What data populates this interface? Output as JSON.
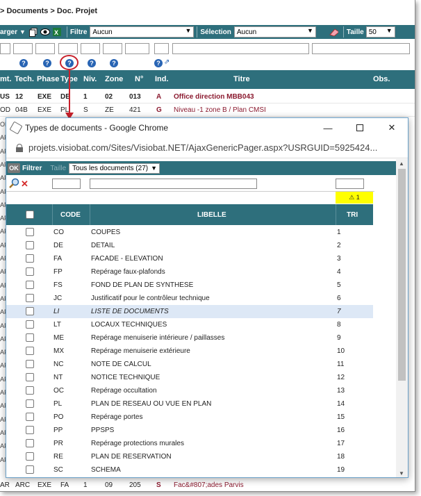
{
  "breadcrumb": "> Documents > Doc. Projet",
  "toolbar": {
    "charger_label": "arger",
    "filtre_label": "Filtre",
    "filtre_value": "Aucun",
    "selection_label": "Sélection",
    "selection_value": "Aucun",
    "taille_label": "Taille",
    "taille_value": "50"
  },
  "bg_table": {
    "headers": [
      "mt.",
      "Tech.",
      "Phase",
      "Type",
      "Niv.",
      "Zone",
      "N°",
      "Ind.",
      "Titre",
      "Obs."
    ],
    "rows": [
      {
        "mt": "US",
        "tech": "12",
        "phase": "EXE",
        "type": "DE",
        "niv": "1",
        "zone": "02",
        "num": "013",
        "ind": "A",
        "titre": "Office direction MBB043"
      },
      {
        "mt": "OD",
        "tech": "04B",
        "phase": "EXE",
        "type": "PL",
        "niv": "S",
        "zone": "ZE",
        "num": "421",
        "ind": "G",
        "titre": "Niveau -1 zone B / Plan CMSI"
      }
    ],
    "left_stub": [
      "OD",
      "AF",
      "AF",
      "AF",
      "AF",
      "AF",
      "AF",
      "AF",
      "AF",
      "AF",
      "AF",
      "AF",
      "AF",
      "AF",
      "AF",
      "AF",
      "AF",
      "AF",
      "AF",
      "AF",
      "AF",
      "AF",
      "AF",
      "AF",
      "AF",
      "AF"
    ],
    "bottom_row": {
      "mt": "AR",
      "tech": "ARC",
      "phase": "EXE",
      "type": "FA",
      "niv": "1",
      "zone": "09",
      "num": "205",
      "ind": "S",
      "titre": "Fac&#807;ades Parvis"
    }
  },
  "popup": {
    "window_title": "Types de documents - Google Chrome",
    "url": "projets.visiobat.com/Sites/Visiobat.NET/AjaxGenericPager.aspx?USRGUID=5925424...",
    "ok_label": "OK",
    "filtrer_label": "Filtrer",
    "taille_label": "Taille",
    "taille_value": "Tous les documents (27)",
    "sort_badge": "1",
    "columns": {
      "code": "CODE",
      "libelle": "LIBELLE",
      "tri": "TRI"
    },
    "rows": [
      {
        "code": "CO",
        "libelle": "COUPES",
        "tri": "1"
      },
      {
        "code": "DE",
        "libelle": "DETAIL",
        "tri": "2"
      },
      {
        "code": "FA",
        "libelle": "FACADE - ELEVATION",
        "tri": "3"
      },
      {
        "code": "FP",
        "libelle": "Repérage faux-plafonds",
        "tri": "4"
      },
      {
        "code": "FS",
        "libelle": "FOND DE PLAN DE SYNTHESE",
        "tri": "5"
      },
      {
        "code": "JC",
        "libelle": "Justificatif pour le contrôleur technique",
        "tri": "6"
      },
      {
        "code": "LI",
        "libelle": "LISTE DE DOCUMENTS",
        "tri": "7"
      },
      {
        "code": "LT",
        "libelle": "LOCAUX TECHNIQUES",
        "tri": "8"
      },
      {
        "code": "ME",
        "libelle": "Repérage menuiserie intérieure / paillasses",
        "tri": "9"
      },
      {
        "code": "MX",
        "libelle": "Repérage menuiserie extérieure",
        "tri": "10"
      },
      {
        "code": "NC",
        "libelle": "NOTE DE CALCUL",
        "tri": "11"
      },
      {
        "code": "NT",
        "libelle": "NOTICE TECHNIQUE",
        "tri": "12"
      },
      {
        "code": "OC",
        "libelle": "Repérage occultation",
        "tri": "13"
      },
      {
        "code": "PL",
        "libelle": "PLAN DE RESEAU OU VUE EN PLAN",
        "tri": "14"
      },
      {
        "code": "PO",
        "libelle": "Repérage portes",
        "tri": "15"
      },
      {
        "code": "PP",
        "libelle": "PPSPS",
        "tri": "16"
      },
      {
        "code": "PR",
        "libelle": "Repérage protections murales",
        "tri": "17"
      },
      {
        "code": "RE",
        "libelle": "PLAN DE RESERVATION",
        "tri": "18"
      },
      {
        "code": "SC",
        "libelle": "SCHEMA",
        "tri": "19"
      }
    ],
    "highlighted_row": 6
  },
  "colors": {
    "header_teal": "#2e6f7c",
    "maroon": "#8b1a2f",
    "annotation_red": "#c8202b",
    "highlight": "#dde8f6",
    "sort_badge": "#ffff00"
  }
}
